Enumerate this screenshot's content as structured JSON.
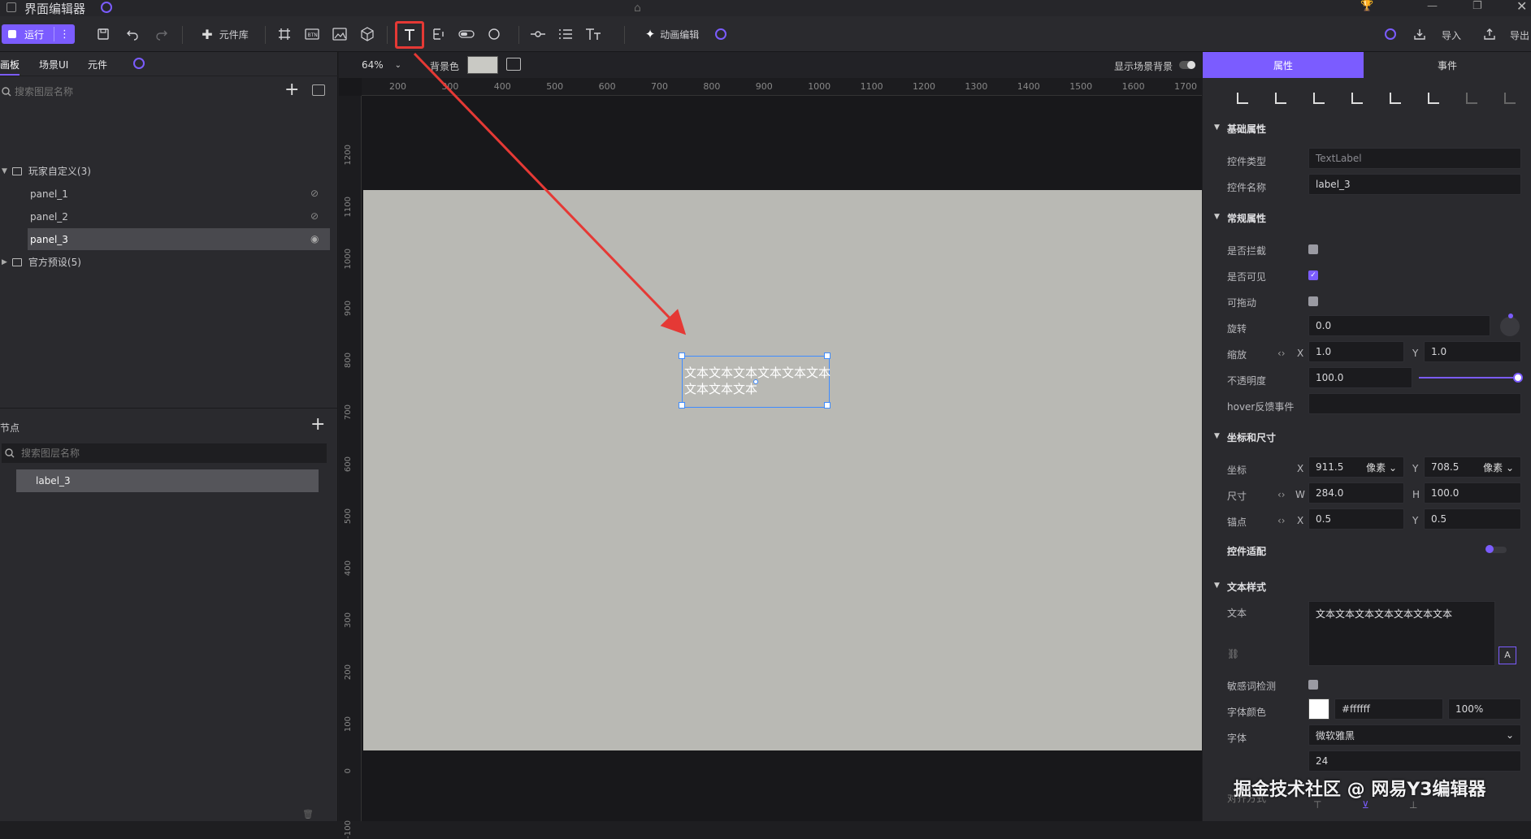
{
  "titlebar": {
    "title": "界面编辑器"
  },
  "toolbar": {
    "run_label": "运行",
    "components_label": "元件库",
    "anim_label": "动画编辑",
    "import_label": "导入",
    "export_label": "导出"
  },
  "left": {
    "tabs": [
      "画板",
      "场景UI",
      "元件"
    ],
    "search_placeholder": "搜索图层名称",
    "tree": [
      {
        "label": "玩家自定义(3)",
        "kind": "folder"
      },
      {
        "label": "panel_1",
        "kind": "item",
        "eye": "hidden"
      },
      {
        "label": "panel_2",
        "kind": "item",
        "eye": "hidden"
      },
      {
        "label": "panel_3",
        "kind": "item",
        "eye": "visible"
      },
      {
        "label": "官方预设(5)",
        "kind": "folder"
      }
    ],
    "nodes_title": "节点",
    "nodes_search_placeholder": "搜索图层名称",
    "nodes": [
      "label_3"
    ]
  },
  "canvas": {
    "zoom": "64%",
    "bg_label": "背景色",
    "show_scene_bg": "显示场景背景",
    "ruler_h": [
      "200",
      "300",
      "400",
      "500",
      "600",
      "700",
      "800",
      "900",
      "1000",
      "1100",
      "1200",
      "1300",
      "1400",
      "1500",
      "1600",
      "1700"
    ],
    "ruler_v": [
      "1200",
      "1100",
      "1000",
      "900",
      "800",
      "700",
      "600",
      "500",
      "400",
      "300",
      "200",
      "100",
      "0",
      "-100"
    ],
    "label_text_line1": "文本文本文本文本文本文本",
    "label_text_line2": "文本文本文本"
  },
  "right": {
    "tabs": [
      "属性",
      "事件"
    ],
    "basic": {
      "title": "基础属性",
      "type_label": "控件类型",
      "type_value": "TextLabel",
      "name_label": "控件名称",
      "name_value": "label_3"
    },
    "common": {
      "title": "常规属性",
      "intercept": "是否拦截",
      "visible": "是否可见",
      "draggable": "可拖动",
      "rotate": "旋转",
      "rotate_value": "0.0",
      "scale": "缩放",
      "scale_x": "1.0",
      "scale_y": "1.0",
      "opacity": "不透明度",
      "opacity_value": "100.0",
      "hover": "hover反馈事件"
    },
    "transform": {
      "title": "坐标和尺寸",
      "pos": "坐标",
      "pos_x": "911.5",
      "pos_y": "708.5",
      "unit": "像素",
      "size": "尺寸",
      "size_w": "284.0",
      "size_h": "100.0",
      "anchor": "锚点",
      "anchor_x": "0.5",
      "anchor_y": "0.5",
      "adapt": "控件适配"
    },
    "textstyle": {
      "title": "文本样式",
      "text_label": "文本",
      "text_value": "文本文本文本文本文本文本文本",
      "sensitive": "敏感词检测",
      "color_label": "字体颜色",
      "color_value": "#ffffff",
      "color_alpha": "100%",
      "font_label": "字体",
      "font_value": "微软雅黑",
      "font_size": "24",
      "align_label": "对齐方式"
    }
  },
  "watermark": "掘金技术社区 @ 网易Y3编辑器",
  "axis_letters": {
    "x": "X",
    "y": "Y",
    "w": "W",
    "h": "H",
    "A": "A"
  },
  "colors": {
    "accent": "#7b5cff",
    "highlight": "#e53935",
    "canvas": "#b9b9b4",
    "selection": "#3f8cff"
  }
}
